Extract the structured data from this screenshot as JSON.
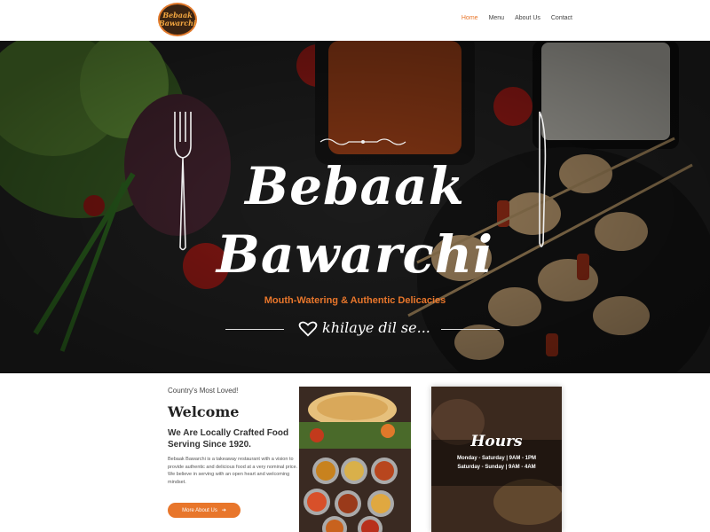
{
  "brand": {
    "logo_line1": "Bebaak",
    "logo_line2": "Bawarchi"
  },
  "nav": {
    "items": [
      {
        "label": "Home",
        "active": true
      },
      {
        "label": "Menu",
        "active": false
      },
      {
        "label": "About Us",
        "active": false
      },
      {
        "label": "Contact",
        "active": false
      }
    ]
  },
  "hero": {
    "title_line1": "Bebaak",
    "title_line2": "Bawarchi",
    "subtitle": "Mouth-Watering & Authentic Delicacies",
    "tagline": "khilaye dil se..."
  },
  "welcome": {
    "kicker": "Country's Most Loved!",
    "title": "Welcome",
    "subtitle": "We Are Locally Crafted Food Serving Since 1920.",
    "body": "Bebaak Bawarchi is a takeaway restaurant with a vision to provide authentic and delicious food at a very nominal price. We believe in serving with an open heart and welcoming mindset.",
    "button_label": "More About Us"
  },
  "hours": {
    "title": "Hours",
    "line1": "Monday - Saturday | 9AM - 1PM",
    "line2": "Saturday - Sunday | 9AM - 4AM"
  },
  "colors": {
    "accent": "#e8762b",
    "hero_bg": "#222222"
  }
}
